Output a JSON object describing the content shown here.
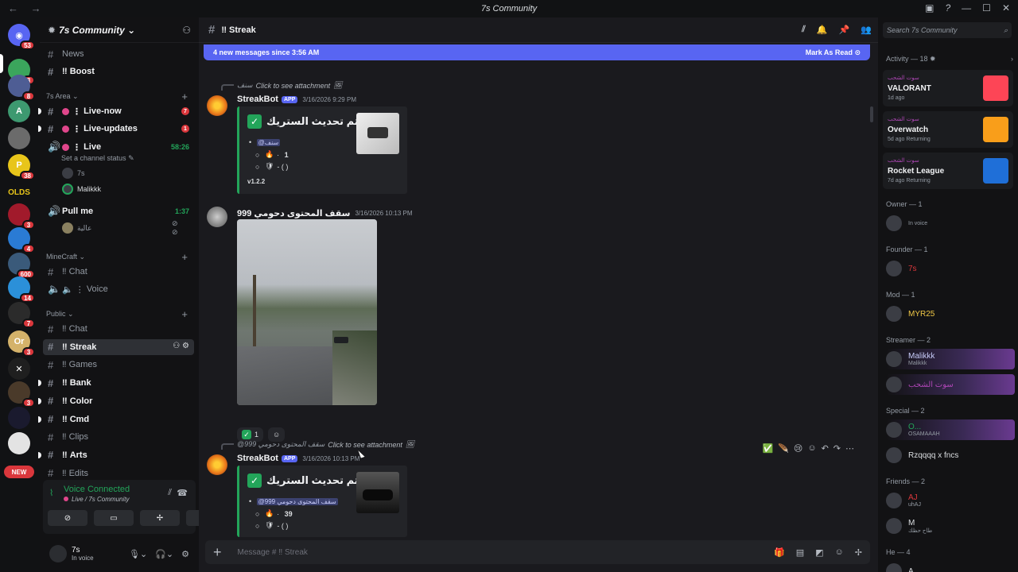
{
  "window": {
    "title": "7s Community"
  },
  "servers": [
    {
      "name": "server-discord-home",
      "badge": "53",
      "color": "#5865f2",
      "glyph": "◉"
    },
    {
      "name": "server-2",
      "badge": "8",
      "color": "#3ba55c",
      "glyph": ""
    },
    {
      "name": "server-3",
      "badge": "8",
      "color": "#4e5d94",
      "glyph": ""
    },
    {
      "name": "server-4",
      "badge": "",
      "color": "#3d9970",
      "glyph": "A"
    },
    {
      "name": "server-5",
      "badge": "",
      "color": "#6b6b6b",
      "glyph": ""
    },
    {
      "name": "server-6",
      "badge": "38",
      "color": "#e8c51a",
      "glyph": "P"
    },
    {
      "name": "server-olds",
      "badge": "",
      "color": "#111214",
      "glyph": "OLDS"
    },
    {
      "name": "server-8",
      "badge": "3",
      "color": "#a11a2b",
      "glyph": ""
    },
    {
      "name": "server-9",
      "badge": "4",
      "color": "#2a7bd4",
      "glyph": ""
    },
    {
      "name": "server-10",
      "badge": "600",
      "color": "#3a5a7a",
      "glyph": ""
    },
    {
      "name": "server-11",
      "badge": "14",
      "color": "#2b90d9",
      "glyph": ""
    },
    {
      "name": "server-12",
      "badge": "7",
      "color": "#2b2b2b",
      "glyph": ""
    },
    {
      "name": "server-13",
      "badge": "3",
      "color": "#d4b26a",
      "glyph": "Or"
    },
    {
      "name": "server-14",
      "badge": "",
      "color": "#1f1f1f",
      "glyph": "✕"
    },
    {
      "name": "server-15",
      "badge": "3",
      "color": "#4a3a2a",
      "glyph": ""
    },
    {
      "name": "server-16",
      "badge": "",
      "color": "#1a1a2e",
      "glyph": ""
    },
    {
      "name": "server-17",
      "badge": "",
      "color": "#e3e3e3",
      "glyph": ""
    }
  ],
  "new_badge": "NEW",
  "sidebar": {
    "server_name": "7s Community",
    "channels": [
      {
        "label": "News",
        "kind": "text"
      },
      {
        "label": "Boost",
        "kind": "text-bold"
      }
    ],
    "cat_7s": "7s Area",
    "area": [
      {
        "label": "Live-now",
        "count": "7"
      },
      {
        "label": "Live-updates",
        "count": "1"
      }
    ],
    "live": {
      "label": "Live",
      "time": "58:26",
      "status": "Set a channel status"
    },
    "live_users": [
      "7s",
      "Malikkk"
    ],
    "pull": {
      "label": "Pull me",
      "time": "1:37",
      "user": "عالية"
    },
    "cat_mc": "MineCraft",
    "mc": [
      {
        "label": "Chat"
      },
      {
        "label": "Voice"
      }
    ],
    "cat_public": "Public",
    "public": [
      {
        "label": "Chat",
        "style": "muted"
      },
      {
        "label": "Streak",
        "style": "selected"
      },
      {
        "label": "Games",
        "style": "muted"
      },
      {
        "label": "Bank",
        "style": "bold"
      },
      {
        "label": "Color",
        "style": "bold"
      },
      {
        "label": "Cmd",
        "style": "bold"
      },
      {
        "label": "Clips",
        "style": "muted"
      },
      {
        "label": "Arts",
        "style": "bold"
      },
      {
        "label": "Edits",
        "style": "muted"
      }
    ]
  },
  "voice": {
    "connected": "Voice Connected",
    "channel": "Live / 7s Community"
  },
  "user": {
    "name": "7s",
    "status": "In voice"
  },
  "channel": {
    "name": "Streak",
    "placeholder": "Message # ‼ Streak"
  },
  "newbar": {
    "text": "4 new messages since 3:56 AM",
    "action": "Mark As Read"
  },
  "messages": {
    "m1": {
      "ref_user": "سنف",
      "ref_text": "Click to see attachment",
      "author": "StreakBot",
      "app": "APP",
      "time": "3/16/2026 9:29 PM",
      "title": "تم تحديث الستريك •",
      "mention": "@سنف",
      "count": "1",
      "shield": "- (          )",
      "version": "v1.2.2"
    },
    "m2": {
      "author": "سقف المحتوى دحومي 999",
      "time": "3/16/2026 10:13 PM",
      "reaction_count": "1"
    },
    "m3": {
      "ref_user": "@سقف المحتوى دحومي 999",
      "ref_text": "Click to see attachment",
      "author": "StreakBot",
      "app": "APP",
      "time": "3/16/2026 10:13 PM",
      "title": "تم تحديث الستريك •",
      "mention": "@سقف المحتوى دحومي 999",
      "count": "39",
      "shield": "- (          )"
    }
  },
  "right": {
    "search_placeholder": "Search 7s Community",
    "activity_header": "Activity — 18",
    "activities": [
      {
        "who": "سوت الشحب",
        "game": "VALORANT",
        "sub": "1d ago",
        "color": "#fd4556"
      },
      {
        "who": "سوت الشحب",
        "game": "Overwatch",
        "sub": "5d ago  Returning",
        "color": "#f99e1a"
      },
      {
        "who": "سوت الشحب",
        "game": "Rocket League",
        "sub": "7d ago  Returning",
        "color": "#1f6fd8"
      }
    ],
    "groups": [
      {
        "header": "Owner — 1",
        "members": [
          {
            "name": "",
            "status": "In voice",
            "color": "#dbdee1"
          }
        ]
      },
      {
        "header": "Founder — 1",
        "members": [
          {
            "name": "7s",
            "status": "",
            "color": "#da373c"
          }
        ]
      },
      {
        "header": "Mod — 1",
        "members": [
          {
            "name": "MYR25",
            "status": "",
            "color": "#f0c846"
          }
        ]
      },
      {
        "header": "Streamer — 2",
        "members": [
          {
            "name": "Malikkk",
            "status": "Malikkk",
            "color": "#c9cdfb"
          },
          {
            "name": "سوت الشحب",
            "status": "",
            "color": "#ae46b5"
          }
        ]
      },
      {
        "header": "Special — 2",
        "members": [
          {
            "name": "O...",
            "status": "OSAMAAAH",
            "color": "#23a55a"
          },
          {
            "name": "Rzqqqq x fncs",
            "status": "",
            "color": "#dbdee1"
          }
        ]
      },
      {
        "header": "Friends — 2",
        "members": [
          {
            "name": "AJ",
            "status": "uhAJ",
            "color": "#da373c"
          },
          {
            "name": "M",
            "status": "طاح حظك",
            "color": "#dbdee1"
          }
        ]
      },
      {
        "header": "He — 4",
        "members": [
          {
            "name": "A",
            "status": "",
            "color": "#dbdee1"
          }
        ]
      }
    ]
  }
}
